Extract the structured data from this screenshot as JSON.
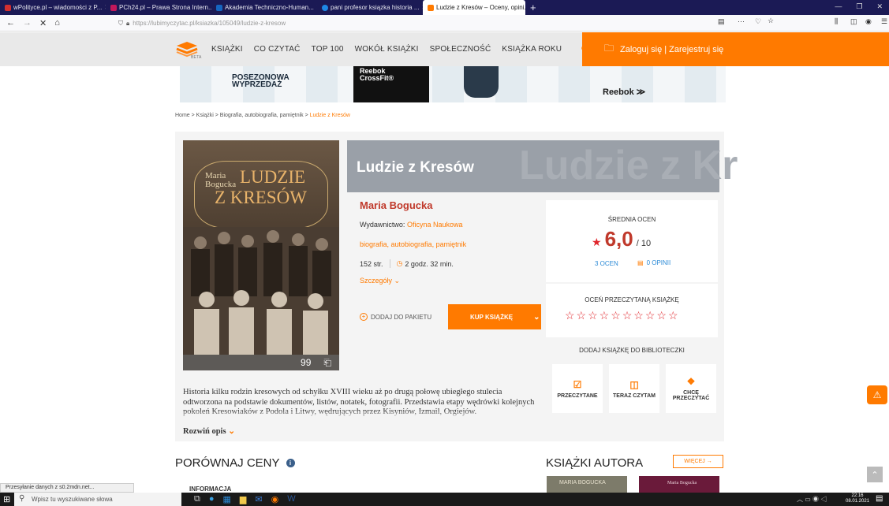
{
  "browser": {
    "tabs": [
      {
        "label": "wPolityce.pl – wiadomości z P...",
        "color": "#d32f2f"
      },
      {
        "label": "PCh24.pl – Prawa Strona Intern...",
        "color": "#c2185b"
      },
      {
        "label": "Akademia Techniczno-Human...",
        "color": "#1565c0"
      },
      {
        "label": "pani profesor ksiązka historia ...",
        "color": "#1e88e5"
      },
      {
        "label": "Ludzie z Kresów – Oceny, opini...",
        "color": "#ff7a00"
      }
    ],
    "url_host": "https://lubimyczytac.pl",
    "url_path": "/ksiazka/105049/ludzie-z-kresow",
    "new_tab": "+",
    "nav_more": "···"
  },
  "site": {
    "logo_sub": "BETA",
    "menu": [
      "KSIĄŻKI",
      "CO CZYTAĆ",
      "TOP 100",
      "WOKÓŁ KSIĄŻKI",
      "SPOŁECZNOŚĆ",
      "KSIĄŻKA ROKU"
    ],
    "login": "Zaloguj się | Zarejestruj się"
  },
  "banner": {
    "sale": "POSEZONOWA WYPRZEDAŻ",
    "product": "Reebok CrossFit®",
    "brand": "Reebok"
  },
  "breadcrumb": {
    "path": "Home > Książki > Biografia, autobiografia, pamiętnik > ",
    "current": "Ludzie z Kresów"
  },
  "book": {
    "title": "Ludzie z Kresów",
    "watermark": "Ludzie z Kr",
    "cover_author": "Maria Bogucka",
    "cover_title_1": "LUDZIE",
    "cover_title_2": "Z KRESÓW",
    "author": "Maria Bogucka",
    "publisher_label": "Wydawnictwo: ",
    "publisher": "Oficyna Naukowa",
    "category": "biografia, autobiografia, pamiętnik",
    "pages": "152 str.",
    "reading_time": "2 godz. 32 min.",
    "details": "Szczegóły",
    "add_to_package": "DODAJ DO PAKIETU",
    "buy": "KUP KSIĄŻKĘ",
    "cover_icons": [
      "99",
      "⌒"
    ]
  },
  "rating": {
    "label": "ŚREDNIA OCEN",
    "value": "6,0",
    "max": "/ 10",
    "ratings": "3 OCEN",
    "opinions": "0 OPINII",
    "rate_label": "OCEŃ PRZECZYTANĄ KSIĄŻKĘ",
    "stars": "☆☆☆☆☆☆☆☆☆☆"
  },
  "library": {
    "label": "DODAJ KSIĄŻKĘ DO BIBLIOTECZKI",
    "read": "PRZECZYTANE",
    "reading": "TERAZ CZYTAM",
    "want": "CHCĘ PRZECZYTAĆ"
  },
  "description": {
    "text": "Historia kilku rodzin kresowych od schyłku XVIII wieku aż po drugą połowę ubiegłego stulecia odtworzona na podstawie dokumentów, listów, notatek, fotografii. Przedstawia etapy wędrówki kolejnych pokoleń Kresowiaków z Podola i Litwy, wędrujących przez Kisyniów, Izmail, Orgiejów.",
    "more": "Rozwiń opis"
  },
  "sections": {
    "compare": "PORÓWNAJ CENY",
    "author_books": "KSIĄŻKI AUTORA",
    "more": "WIĘCEJ",
    "info": "INFORMACJA",
    "author_book_1": "MARIA BOGUCKA",
    "author_book_2": "Maria Bogucka"
  },
  "status": "Przesyłanie danych z s0.2mdn.net...",
  "taskbar": {
    "search": "Wpisz tu wyszukiwane słowa",
    "time": "22:16",
    "date": "08.01.2021"
  }
}
